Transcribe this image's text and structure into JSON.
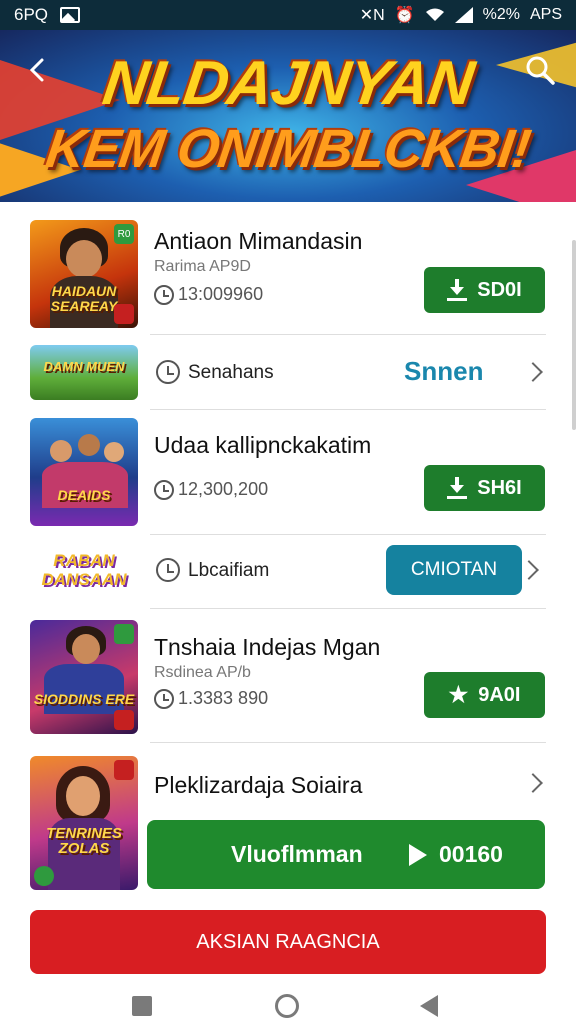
{
  "status_bar": {
    "time": "6PQ",
    "battery_text": "%2%",
    "carrier": "APS",
    "nfc_text": "✕N"
  },
  "banner": {
    "title_line1": "NLDAJNYAN",
    "title_line2": "KEM ONIMBLCKBI!"
  },
  "apps": [
    {
      "name": "Antiaon Mimandasin",
      "sub": "Rarima AP9D",
      "downloads": "13:009960",
      "button": "SD0I",
      "thumb_text": "HAIDAUN SEAREAY",
      "thumb_badge": "R0"
    },
    {
      "row_text": "Senahans",
      "link": "Snnen",
      "thumb_text": "DAMN MUEN"
    },
    {
      "name": "Udaa kallipnckakatim",
      "downloads": "12,300,200",
      "button": "SH6I",
      "thumb_text": "DEAIDS"
    },
    {
      "row_text": "Lbcaifiam",
      "button": "CMIOTAN",
      "thumb_text": "RABAN DANSAAN"
    },
    {
      "name": "Tnshaia Indejas Mgan",
      "sub": "Rsdinea AP/b",
      "downloads": "1.3383 890",
      "button": "9A0I",
      "thumb_text": "SIODDINS ERE"
    },
    {
      "name": "Pleklizardaja Soiaira",
      "thumb_text": "TENRINES ZOLAS"
    }
  ],
  "play_bar": {
    "label": "Vluoflmman",
    "time": "00160"
  },
  "red_bar": {
    "label": "AKSIAN RAAGNCIA"
  },
  "colors": {
    "green": "#1e7d2c",
    "teal": "#15829f",
    "red": "#d81e22",
    "banner_blue": "#1d5fb0"
  }
}
